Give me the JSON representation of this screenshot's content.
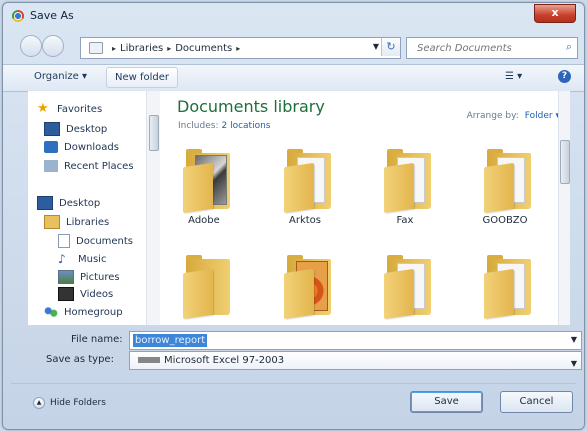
{
  "window": {
    "title": "Save As",
    "close_label": "x"
  },
  "nav": {
    "breadcrumb": [
      "Libraries",
      "Documents"
    ],
    "separator": "▸",
    "search_placeholder": "Search Documents"
  },
  "toolbar": {
    "organize": "Organize ▾",
    "new_folder": "New folder",
    "view": "☰ ▾",
    "help": "?"
  },
  "sidebar": {
    "items": [
      {
        "label": "Favorites",
        "icon": "star-icon"
      },
      {
        "label": "Desktop",
        "icon": "desktop-icon"
      },
      {
        "label": "Downloads",
        "icon": "downloads-icon"
      },
      {
        "label": "Recent Places",
        "icon": "recent-places-icon"
      },
      {
        "label": "Desktop",
        "icon": "desktop-icon"
      },
      {
        "label": "Libraries",
        "icon": "libraries-icon"
      },
      {
        "label": "Documents",
        "icon": "documents-icon"
      },
      {
        "label": "Music",
        "icon": "music-icon"
      },
      {
        "label": "Pictures",
        "icon": "pictures-icon"
      },
      {
        "label": "Videos",
        "icon": "videos-icon"
      },
      {
        "label": "Homegroup",
        "icon": "homegroup-icon"
      }
    ]
  },
  "content": {
    "title": "Documents library",
    "includes_label": "Includes:",
    "includes_link": "2 locations",
    "arrange_label": "Arrange by:",
    "arrange_value": "Folder ▾",
    "folders": [
      {
        "name": "Adobe"
      },
      {
        "name": "Arktos"
      },
      {
        "name": "Fax"
      },
      {
        "name": "GOOBZO"
      }
    ]
  },
  "form": {
    "file_name_label": "File name:",
    "file_name_value": "borrow_report",
    "save_type_label": "Save as type:",
    "save_type_value": "Microsoft Excel 97-2003"
  },
  "footer": {
    "hide_folders": "Hide Folders",
    "save": "Save",
    "cancel": "Cancel"
  },
  "colors": {
    "accent": "#1f5fae",
    "library_title": "#1e6e3a",
    "selection": "#3d86d8"
  }
}
